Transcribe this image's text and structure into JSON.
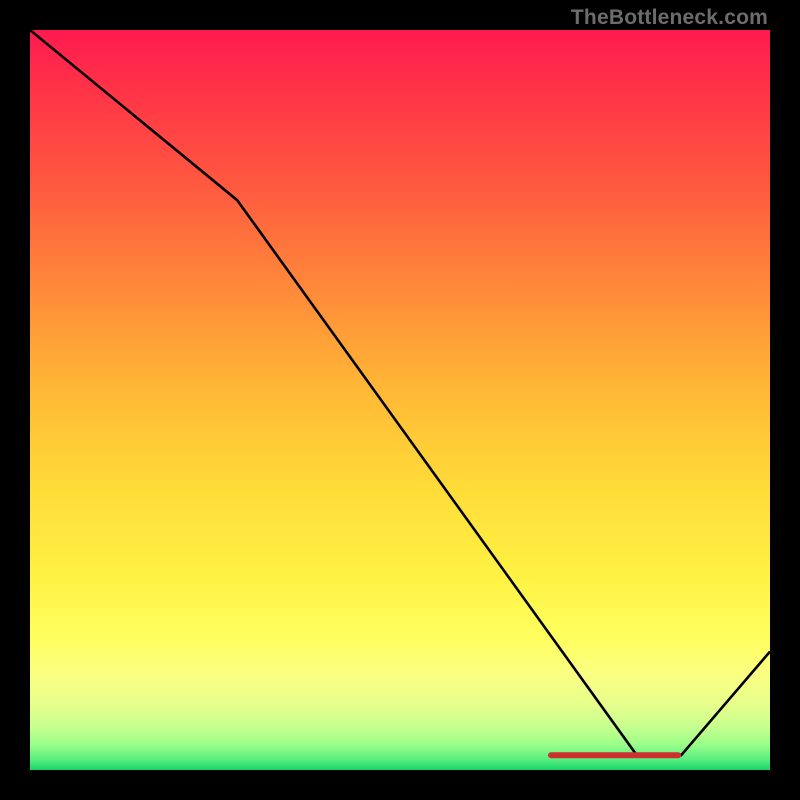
{
  "watermark": "TheBottleneck.com",
  "chart_data": {
    "type": "line",
    "title": "",
    "xlabel": "",
    "ylabel": "",
    "xlim": [
      0,
      100
    ],
    "ylim": [
      0,
      100
    ],
    "series": [
      {
        "name": "curve",
        "x": [
          0,
          28,
          82,
          88,
          100
        ],
        "values": [
          100,
          77,
          2,
          2,
          16
        ]
      }
    ],
    "marker": {
      "x_start": 70,
      "x_end": 88,
      "y": 2,
      "color": "#cc3030"
    },
    "background_gradient": {
      "direction": "top-to-bottom",
      "stops": [
        {
          "offset": 0.0,
          "color": "#ff1a4f"
        },
        {
          "offset": 0.5,
          "color": "#ffc037"
        },
        {
          "offset": 0.85,
          "color": "#fff95c"
        },
        {
          "offset": 1.0,
          "color": "#18d46a"
        }
      ]
    }
  }
}
